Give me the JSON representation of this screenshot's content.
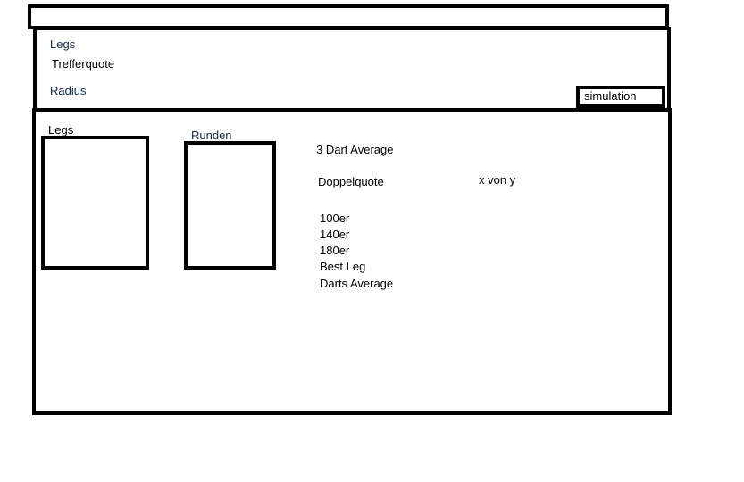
{
  "title_bar": {
    "text": ""
  },
  "settings": {
    "legs_label": "Legs",
    "trefferquote_label": "Trefferquote",
    "radius_label": "Radius",
    "simulation_button": "simulation"
  },
  "results": {
    "legs_panel_label": "Legs",
    "runden_panel_label": "Runden",
    "three_dart_average": "3 Dart Average",
    "doppelquote": "Doppelquote",
    "doppelquote_value": "x von y",
    "stats": [
      "100er",
      "140er",
      "180er",
      "Best Leg",
      "Darts Average"
    ]
  }
}
